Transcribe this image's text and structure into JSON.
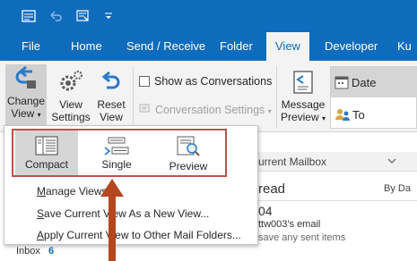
{
  "colors": {
    "brand": "#0f6cbd",
    "highlight": "#c0504d",
    "arrow": "#b5471f"
  },
  "qat": {
    "icons": [
      "send-receive-icon",
      "undo-icon",
      "touch-mode-icon",
      "customize-dropdown-icon"
    ]
  },
  "tabs": [
    "File",
    "Home",
    "Send / Receive",
    "Folder",
    "View",
    "Developer",
    "Ku"
  ],
  "active_tab": "View",
  "ribbon": {
    "change_view": [
      "Change",
      "View"
    ],
    "view_settings": [
      "View",
      "Settings"
    ],
    "reset_view": [
      "Reset",
      "View"
    ],
    "show_as_conversations": "Show as Conversations",
    "conversation_settings": "Conversation Settings",
    "message_preview": [
      "Message",
      "Preview"
    ],
    "arrangement": {
      "date": "Date",
      "to": "To"
    }
  },
  "mail": {
    "search_scope": "urrent Mailbox",
    "header_left": "read",
    "header_right": "By Da",
    "item_title": "04",
    "item_from": "ttw003's email",
    "item_preview": "save any sent items",
    "folder": "Inbox",
    "folder_count": "6"
  },
  "dropdown": {
    "views": [
      "Compact",
      "Single",
      "Preview"
    ],
    "selected_view": "Compact",
    "menu": [
      {
        "pre": "",
        "key": "M",
        "post": "anage Views..."
      },
      {
        "pre": "",
        "key": "S",
        "post": "ave Current View As a New View..."
      },
      {
        "pre": "",
        "key": "A",
        "post": "pply Current View to Other Mail Folders..."
      }
    ]
  }
}
